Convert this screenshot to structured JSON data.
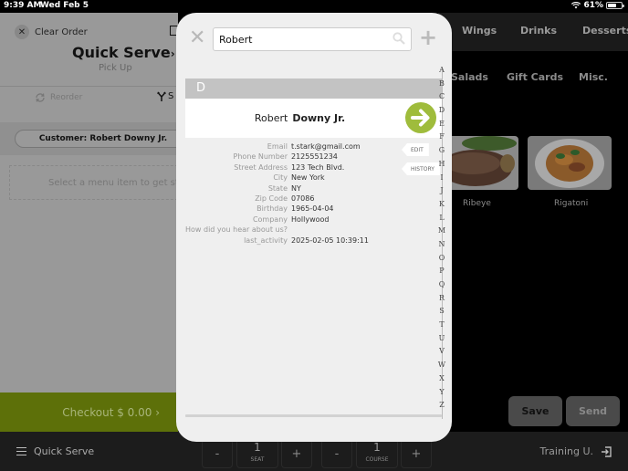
{
  "status_bar": {
    "time": "9:39 AM",
    "date": "Wed Feb 5",
    "battery_text": "61%",
    "battery_level": 0.61
  },
  "order_panel": {
    "clear_label": "Clear Order",
    "title": "Quick Serve",
    "title_chevron": "›",
    "subtitle": "Pick Up",
    "reorder_label": "Reorder",
    "split_label": "S",
    "customer_label": "Customer: Robert Downy Jr.",
    "empty_message": "Select a menu item to get started",
    "checkout_label": "Checkout $ 0.00 ›"
  },
  "menu_panel": {
    "categories_top": [
      "Wings",
      "Drinks",
      "Desserts"
    ],
    "categories_sub": [
      "Salads",
      "Gift Cards",
      "Misc."
    ],
    "items": [
      {
        "label": "Ribeye"
      },
      {
        "label": "Rigatoni"
      }
    ],
    "save_label": "Save",
    "send_label": "Send"
  },
  "bottom_bar": {
    "menu_label": "Quick Serve",
    "seat": {
      "minus": "-",
      "value": "1",
      "label": "SEAT",
      "plus": "+"
    },
    "course": {
      "minus": "-",
      "value": "1",
      "label": "COURSE",
      "plus": "+"
    },
    "user_label": "Training U."
  },
  "customer_modal": {
    "close_symbol": "✕",
    "search_value": "Robert",
    "add_symbol": "+",
    "section_letter": "D",
    "customer": {
      "first_name": "Robert",
      "last_name": "Downy Jr."
    },
    "details": [
      {
        "key": "Email",
        "value": "t.stark@gmail.com"
      },
      {
        "key": "Phone Number",
        "value": "2125551234"
      },
      {
        "key": "Street Address",
        "value": "123 Tech Blvd."
      },
      {
        "key": "City",
        "value": "New York"
      },
      {
        "key": "State",
        "value": "NY"
      },
      {
        "key": "Zip Code",
        "value": "07086"
      },
      {
        "key": "Birthday",
        "value": "1965-04-04"
      },
      {
        "key": "Company",
        "value": "Hollywood"
      },
      {
        "key": "How did you hear about us?",
        "value": ""
      },
      {
        "key": "last_activity",
        "value": "2025-02-05 10:39:11"
      }
    ],
    "edit_label": "EDIT",
    "history_label": "HISTORY",
    "alphabet": [
      "A",
      "B",
      "C",
      "D",
      "E",
      "F",
      "G",
      "H",
      "I",
      "J",
      "K",
      "L",
      "M",
      "N",
      "O",
      "P",
      "Q",
      "R",
      "S",
      "T",
      "U",
      "V",
      "W",
      "X",
      "Y",
      "Z"
    ]
  },
  "colors": {
    "checkout_green": "#5d7009",
    "go_button_green": "#9fbc3c",
    "modal_bg": "#efefef",
    "overlay_gray": "#999999"
  }
}
